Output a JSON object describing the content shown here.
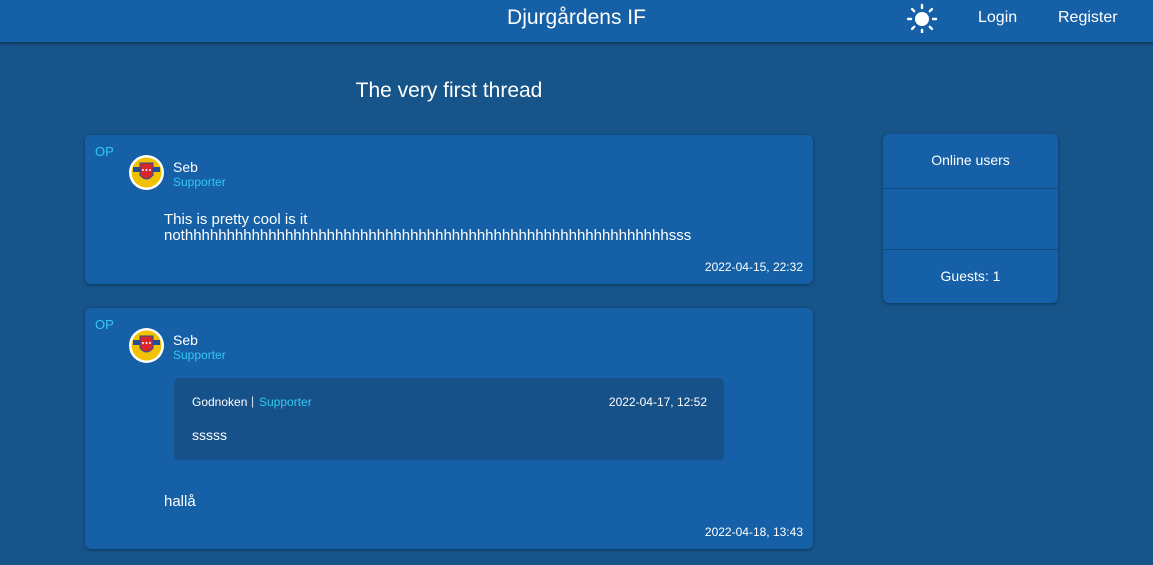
{
  "header": {
    "brand": "Djurgårdens IF",
    "login": "Login",
    "register": "Register",
    "theme_icon": "sun-icon"
  },
  "thread": {
    "title": "The very first thread"
  },
  "posts": [
    {
      "badge": "OP",
      "author": "Seb",
      "role": "Supporter",
      "avatar_icon": "djurgarden-crest",
      "body_line1": "This is pretty cool is it",
      "body_line2": "nothhhhhhhhhhhhhhhhhhhhhhhhhhhhhhhhhhhhhhhhhhhhhhhhhhhhhhhhhhsss",
      "date": "2022-04-15, 22:32"
    },
    {
      "badge": "OP",
      "author": "Seb",
      "role": "Supporter",
      "avatar_icon": "djurgarden-crest",
      "quote": {
        "author": "Godnoken",
        "separator": "|",
        "role": "Supporter",
        "date": "2022-04-17, 12:52",
        "text": "sssss"
      },
      "body": "hallå",
      "date": "2022-04-18, 13:43"
    }
  ],
  "online": {
    "title": "Online users",
    "guests": "Guests: 1"
  },
  "colors": {
    "background": "#16548a",
    "panel": "#1560a6",
    "accent": "#32c9f2",
    "quote": "#16518a"
  }
}
